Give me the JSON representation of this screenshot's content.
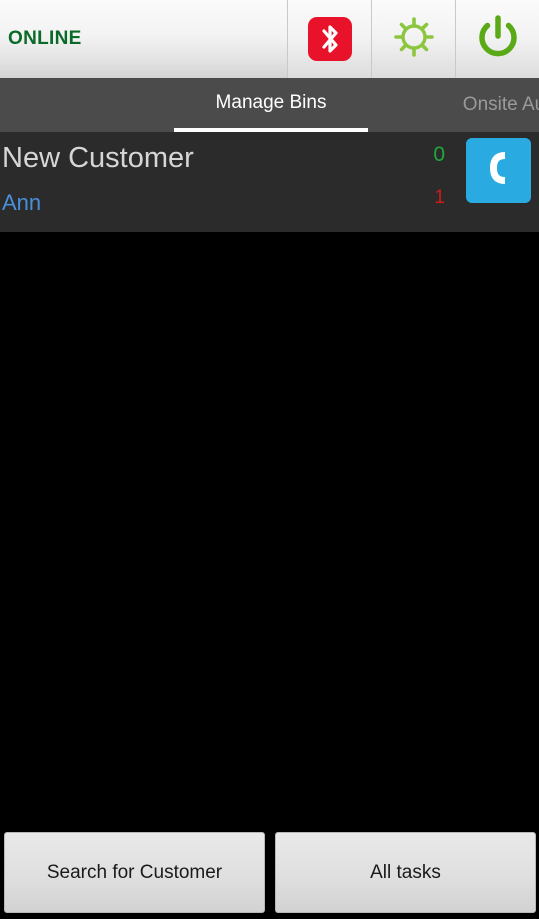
{
  "statusbar": {
    "status_text": "ONLINE",
    "status_color": "#0a6b28",
    "buttons": [
      {
        "name": "bluetooth-icon",
        "label": "Bluetooth",
        "color": "#e8132a"
      },
      {
        "name": "gear-icon",
        "label": "Settings",
        "color": "#8cc63e"
      },
      {
        "name": "power-icon",
        "label": "Power",
        "color": "#5aa916"
      }
    ]
  },
  "tabs": [
    {
      "label": "Manage Bins",
      "selected": true
    },
    {
      "label": "Onsite Au",
      "selected": false
    }
  ],
  "customer": {
    "name": "New Customer",
    "subtitle": "Ann",
    "count_green": "0",
    "count_red": "1",
    "phone_icon": "phone-icon"
  },
  "bottom_buttons": [
    {
      "label": "Search for Customer"
    },
    {
      "label": "All tasks"
    }
  ]
}
